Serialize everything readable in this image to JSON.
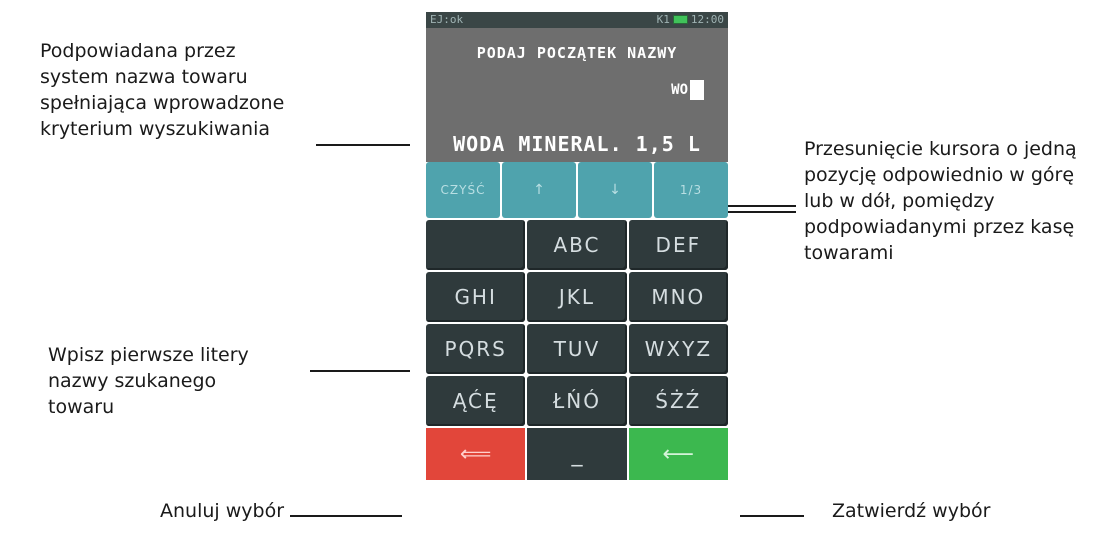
{
  "annotations": {
    "suggested_name": [
      "Podpowiadana przez",
      "system nazwa towaru",
      "spełniająca wprowadzone",
      "kryterium wyszukiwania"
    ],
    "cursor_move": [
      "Przesunięcie kursora o jedną",
      "pozycję odpowiednio w górę",
      "lub w dół, pomiędzy",
      "podpowiadanymi przez kasę",
      "towarami"
    ],
    "type_letters": [
      "Wpisz pierwsze litery",
      "nazwy szukanego",
      "towaru"
    ],
    "cancel": "Anuluj wybór",
    "confirm": "Zatwierdź wybór"
  },
  "status": {
    "ej": "EJ:ok",
    "k": "K1",
    "time": "12:00"
  },
  "screen": {
    "prompt": "PODAJ POCZĄTEK NAZWY",
    "typed": "WO",
    "suggestion": "WODA MINERAL. 1,5 L"
  },
  "function_row": {
    "clear": "CZYŚĆ",
    "up": "↑",
    "down": "↓",
    "page": "1/3"
  },
  "keypad": [
    "",
    "ABC",
    "DEF",
    "GHI",
    "JKL",
    "MNO",
    "PQRS",
    "TUV",
    "WXYZ",
    "ĄĆĘ",
    "ŁŃÓ",
    "ŚŻŹ"
  ],
  "bottom": {
    "cancel": "⟸",
    "space": "_",
    "confirm": "⟵"
  },
  "colors": {
    "cancel": "#e2463a",
    "confirm": "#3cb84f",
    "function_row": "#4fa3ad",
    "key": "#2f3a3c",
    "screen": "#6e6e6e"
  }
}
